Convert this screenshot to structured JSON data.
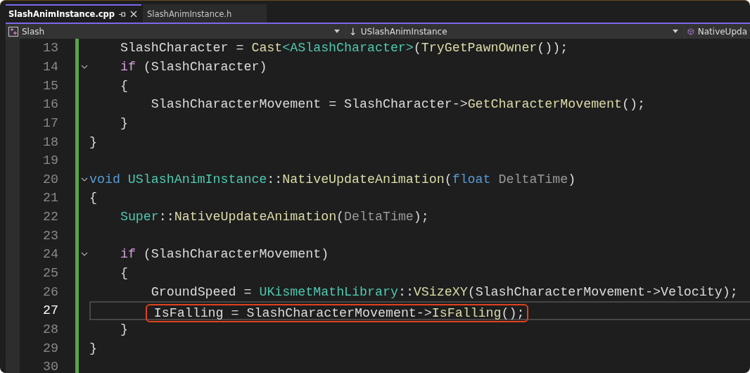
{
  "tabs": [
    {
      "label": "SlashAnimInstance.cpp",
      "selected": true,
      "pinned": true
    },
    {
      "label": "SlashAnimInstance.h",
      "selected": false,
      "pinned": false
    }
  ],
  "navigation_bar": {
    "project": "Slash",
    "scope_arrow": "↓",
    "class_scope": "USlashAnimInstance",
    "member": "NativeUpda"
  },
  "editor": {
    "lines": [
      {
        "number": "13",
        "fold": false,
        "current": false,
        "annotated": false,
        "tokens": [
          {
            "text": "    SlashCharacter = ",
            "kind": "plain"
          },
          {
            "text": "Cast",
            "kind": "function"
          },
          {
            "text": "<ASlashCharacter>",
            "kind": "type"
          },
          {
            "text": "(",
            "kind": "plain"
          },
          {
            "text": "TryGetPawnOwner",
            "kind": "function"
          },
          {
            "text": "());",
            "kind": "plain"
          }
        ]
      },
      {
        "number": "14",
        "fold": true,
        "current": false,
        "annotated": false,
        "tokens": [
          {
            "text": "    if",
            "kind": "control"
          },
          {
            "text": " (SlashCharacter)",
            "kind": "plain"
          }
        ]
      },
      {
        "number": "15",
        "fold": false,
        "current": false,
        "annotated": false,
        "tokens": [
          {
            "text": "    {",
            "kind": "plain"
          }
        ]
      },
      {
        "number": "16",
        "fold": false,
        "current": false,
        "annotated": false,
        "tokens": [
          {
            "text": "        SlashCharacterMovement = SlashCharacter->",
            "kind": "plain"
          },
          {
            "text": "GetCharacterMovement",
            "kind": "function"
          },
          {
            "text": "();",
            "kind": "plain"
          }
        ]
      },
      {
        "number": "17",
        "fold": false,
        "current": false,
        "annotated": false,
        "tokens": [
          {
            "text": "    }",
            "kind": "plain"
          }
        ]
      },
      {
        "number": "18",
        "fold": false,
        "current": false,
        "annotated": false,
        "tokens": [
          {
            "text": "}",
            "kind": "plain"
          }
        ]
      },
      {
        "number": "19",
        "fold": false,
        "current": false,
        "annotated": false
      },
      {
        "number": "20",
        "fold": true,
        "current": false,
        "annotated": false,
        "tokens": [
          {
            "text": "void",
            "kind": "keyword"
          },
          {
            "text": " USlashAnimInstance",
            "kind": "type"
          },
          {
            "text": "::",
            "kind": "plain"
          },
          {
            "text": "NativeUpdateAnimation",
            "kind": "function"
          },
          {
            "text": "(",
            "kind": "plain"
          },
          {
            "text": "float",
            "kind": "keyword"
          },
          {
            "text": " DeltaTime",
            "kind": "param"
          },
          {
            "text": ")",
            "kind": "plain"
          }
        ]
      },
      {
        "number": "21",
        "fold": false,
        "current": false,
        "annotated": false,
        "tokens": [
          {
            "text": "{",
            "kind": "plain"
          }
        ]
      },
      {
        "number": "22",
        "fold": false,
        "current": false,
        "annotated": false,
        "tokens": [
          {
            "text": "    Super",
            "kind": "type"
          },
          {
            "text": "::",
            "kind": "plain"
          },
          {
            "text": "NativeUpdateAnimation",
            "kind": "function"
          },
          {
            "text": "(",
            "kind": "plain"
          },
          {
            "text": "DeltaTime",
            "kind": "param"
          },
          {
            "text": ");",
            "kind": "plain"
          }
        ]
      },
      {
        "number": "23",
        "fold": false,
        "current": false,
        "annotated": false
      },
      {
        "number": "24",
        "fold": true,
        "current": false,
        "annotated": false,
        "tokens": [
          {
            "text": "    if",
            "kind": "control"
          },
          {
            "text": " (SlashCharacterMovement)",
            "kind": "plain"
          }
        ]
      },
      {
        "number": "25",
        "fold": false,
        "current": false,
        "annotated": false,
        "tokens": [
          {
            "text": "    {",
            "kind": "plain"
          }
        ]
      },
      {
        "number": "26",
        "fold": false,
        "current": false,
        "annotated": false,
        "tokens": [
          {
            "text": "        GroundSpeed = ",
            "kind": "plain"
          },
          {
            "text": "UKismetMathLibrary",
            "kind": "type"
          },
          {
            "text": "::",
            "kind": "plain"
          },
          {
            "text": "VSizeXY",
            "kind": "function"
          },
          {
            "text": "(SlashCharacterMovement->Velocity);",
            "kind": "plain"
          }
        ]
      },
      {
        "number": "27",
        "fold": false,
        "current": true,
        "annotated": true,
        "tokens": [
          {
            "text": "        IsFalling = SlashCharacterMovement->",
            "kind": "plain"
          },
          {
            "text": "IsFalling",
            "kind": "function"
          },
          {
            "text": "();",
            "kind": "plain"
          }
        ]
      },
      {
        "number": "28",
        "fold": false,
        "current": false,
        "annotated": false,
        "tokens": [
          {
            "text": "    }",
            "kind": "plain"
          }
        ]
      },
      {
        "number": "29",
        "fold": false,
        "current": false,
        "annotated": false,
        "tokens": [
          {
            "text": "}",
            "kind": "plain"
          }
        ]
      },
      {
        "number": "30",
        "fold": false,
        "current": false,
        "annotated": false
      }
    ]
  }
}
